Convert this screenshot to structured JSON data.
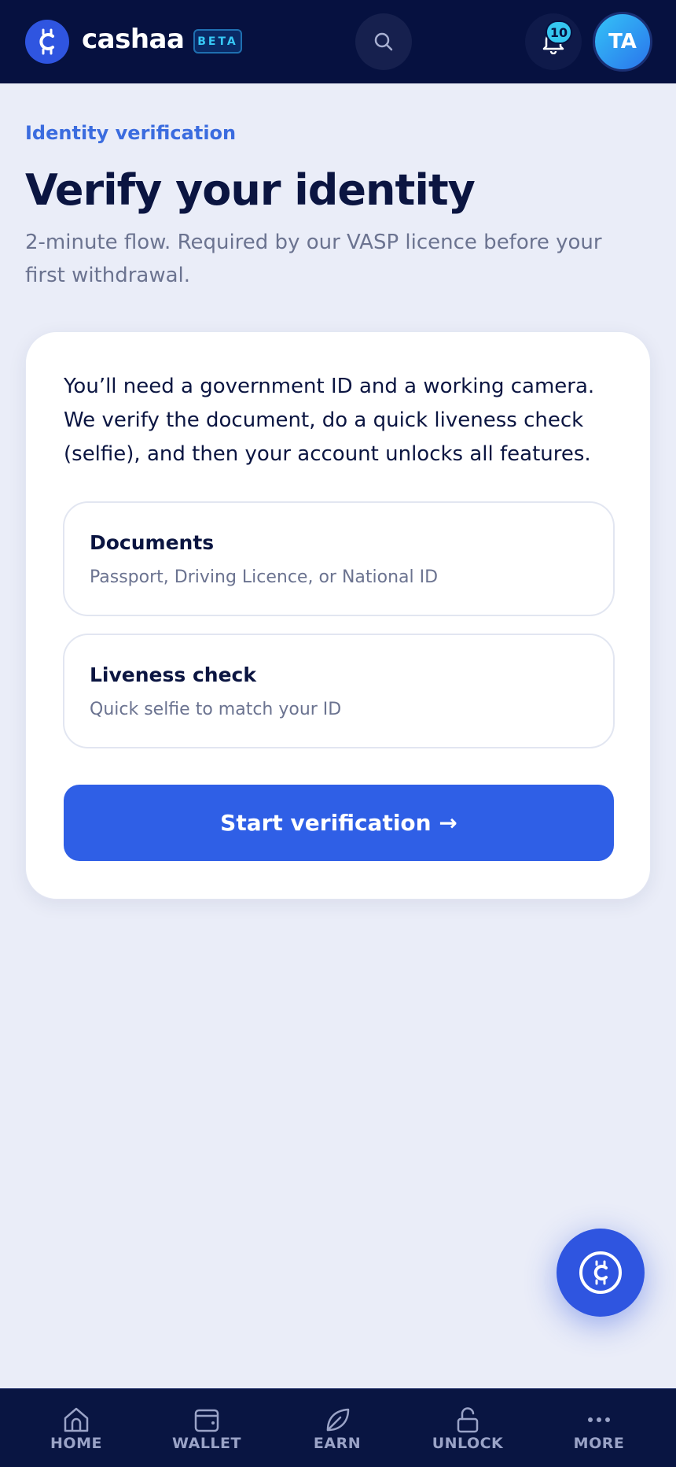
{
  "header": {
    "brand": "cashaa",
    "badge": "BETA",
    "notification_count": "10",
    "avatar_initials": "TA",
    "icons": {
      "logo": "cashaa-logo-icon",
      "search": "search-icon",
      "bell": "bell-icon"
    }
  },
  "page": {
    "eyebrow": "Identity verification",
    "title": "Verify your identity",
    "subtitle": "2-minute flow. Required by our VASP licence before your first withdrawal."
  },
  "card": {
    "intro": "You’ll need a government ID and a working camera. We verify the document, do a quick liveness check (selfie), and then your account unlocks all features.",
    "options": [
      {
        "title": "Documents",
        "description": "Passport, Driving Licence, or National ID"
      },
      {
        "title": "Liveness check",
        "description": "Quick selfie to match your ID"
      }
    ],
    "cta_label": "Start verification →"
  },
  "fab": {
    "icon": "cashaa-logo-icon"
  },
  "bottom_nav": {
    "items": [
      {
        "label": "HOME",
        "icon": "home-icon"
      },
      {
        "label": "WALLET",
        "icon": "wallet-icon"
      },
      {
        "label": "EARN",
        "icon": "leaf-icon"
      },
      {
        "label": "UNLOCK",
        "icon": "unlock-icon"
      },
      {
        "label": "MORE",
        "icon": "more-dots-icon"
      }
    ]
  },
  "colors": {
    "header_bg": "#061140",
    "accent": "#2f5fe6",
    "eyebrow": "#3b6cdf",
    "page_bg": "#eaedf8"
  }
}
